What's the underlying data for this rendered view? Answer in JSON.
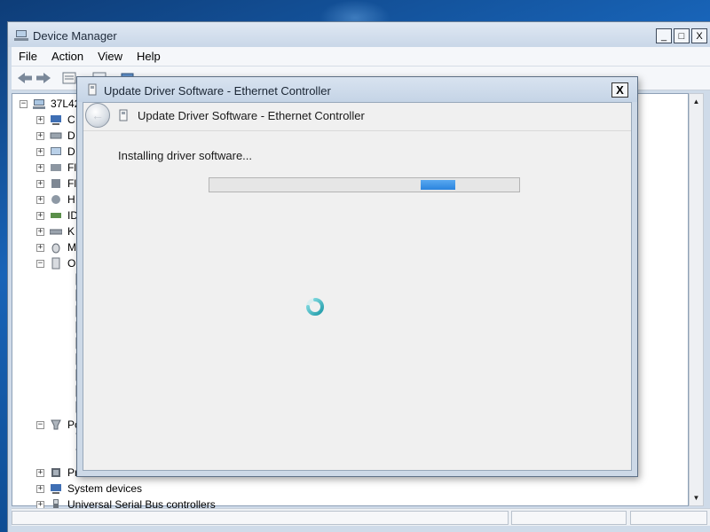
{
  "device_manager": {
    "title": "Device Manager",
    "window_buttons": {
      "minimize": "_",
      "maximize": "□",
      "close": "X"
    },
    "menu": [
      "File",
      "Action",
      "View",
      "Help"
    ],
    "tree": {
      "root_label": "37L42",
      "items": [
        {
          "label": "C",
          "expander": "+"
        },
        {
          "label": "D",
          "expander": "+"
        },
        {
          "label": "D",
          "expander": "+"
        },
        {
          "label": "Fl",
          "expander": "+"
        },
        {
          "label": "Fl",
          "expander": "+"
        },
        {
          "label": "H",
          "expander": "+"
        },
        {
          "label": "ID",
          "expander": "+"
        },
        {
          "label": "K",
          "expander": "+"
        },
        {
          "label": "M",
          "expander": "+"
        },
        {
          "label": "O",
          "expander": "−"
        },
        {
          "label": "Pc",
          "expander": "−"
        },
        {
          "label": "Pr",
          "expander": "+"
        },
        {
          "label": "System devices",
          "expander": "+"
        },
        {
          "label": "Universal Serial Bus controllers",
          "expander": "+"
        }
      ]
    },
    "scroll": {
      "up": "▲",
      "down": "▼"
    }
  },
  "dialog": {
    "title": "Update Driver Software - Ethernet Controller",
    "header_title": "Update Driver Software - Ethernet Controller",
    "close_label": "X",
    "back_arrow": "←",
    "status_text": "Installing driver software...",
    "progress": {
      "mode": "indeterminate"
    }
  },
  "colors": {
    "progress_fill": "#2b84de",
    "spinner": "#2bb3c0",
    "warning_icon": "#e8c21a"
  }
}
